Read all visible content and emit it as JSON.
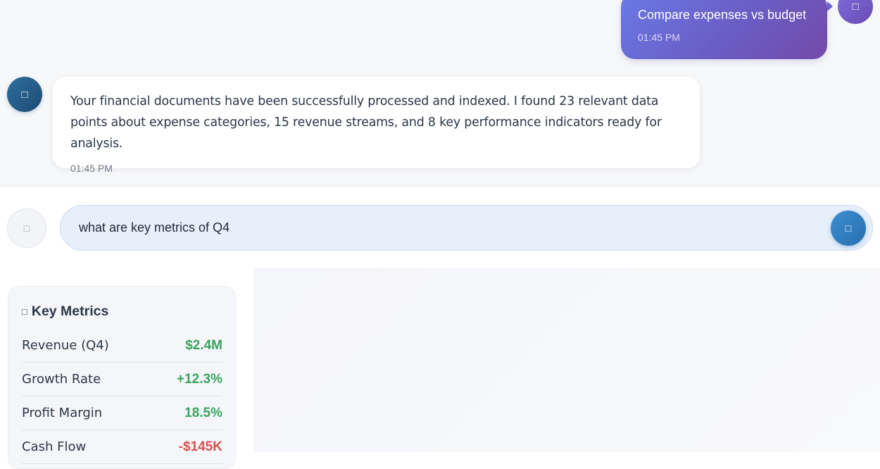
{
  "messages": {
    "user": {
      "text": "Compare expenses vs budget",
      "time": "01:45 PM",
      "avatar_icon": "user-icon"
    },
    "bot": {
      "text": "Your financial documents have been successfully processed and indexed. I found 23 relevant data points about expense categories, 15 revenue streams, and 8 key performance indicators ready for analysis.",
      "time": "01:45 PM",
      "avatar_icon": "robot-icon"
    }
  },
  "composer": {
    "value": "what are key metrics of Q4",
    "attach_icon": "paperclip-icon",
    "send_icon": "send-icon",
    "icon_glyph": "□"
  },
  "metrics": {
    "title": "Key Metrics",
    "title_icon": "chart-icon",
    "items": [
      {
        "label": "Revenue (Q4)",
        "value": "$2.4M",
        "trend": "positive"
      },
      {
        "label": "Growth Rate",
        "value": "+12.3%",
        "trend": "positive"
      },
      {
        "label": "Profit Margin",
        "value": "18.5%",
        "trend": "positive"
      },
      {
        "label": "Cash Flow",
        "value": "-$145K",
        "trend": "negative"
      }
    ]
  },
  "colors": {
    "positive": "#3aa35f",
    "negative": "#d9534f",
    "user_bubble": "#6a5dc4",
    "send_button": "#2a6fb0"
  }
}
